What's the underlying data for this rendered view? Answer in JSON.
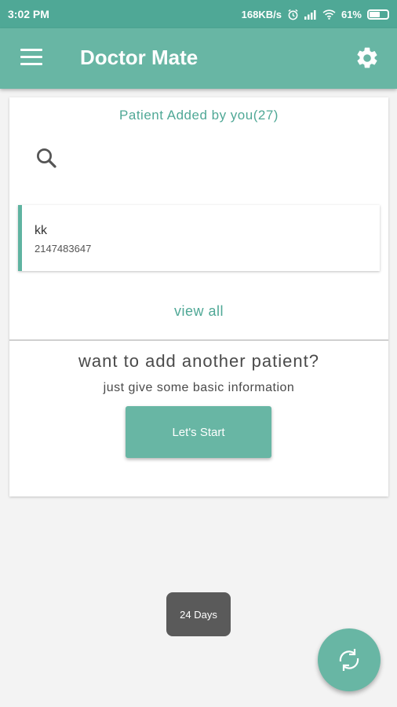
{
  "status_bar": {
    "time": "3:02 PM",
    "network_speed": "168KB/s",
    "battery": "61%",
    "battery_level": 0.61,
    "icons": [
      "alarm-icon",
      "signal-icon",
      "wifi-icon",
      "battery-icon"
    ]
  },
  "app_bar": {
    "title": "Doctor Mate",
    "menu_icon": "menu-icon",
    "settings_icon": "gear-icon"
  },
  "patients_card": {
    "title": "Patient Added by you(27)",
    "search_icon": "search-icon",
    "items": [
      {
        "name": "kk",
        "phone": "2147483647"
      }
    ],
    "view_all_label": "view all"
  },
  "add_patient": {
    "question": "want to add another patient?",
    "subtext": "just give some basic information",
    "start_label": "Let's Start"
  },
  "toast": {
    "text": "24 Days"
  },
  "fab": {
    "icon": "refresh-icon"
  },
  "colors": {
    "status_bar": "#4fa896",
    "primary": "#68b6a4",
    "accent_text": "#4fa896",
    "background": "#f3f3f3"
  }
}
